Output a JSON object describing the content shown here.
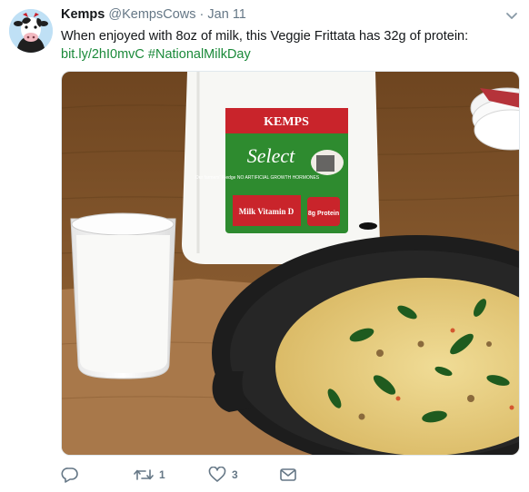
{
  "tweet": {
    "author_name": "Kemps",
    "author_handle": "@KempsCows",
    "separator": "·",
    "date": "Jan 11",
    "text": "When enjoyed with 8oz of milk, this Veggie Frittata has 32g of protein:",
    "link": "bit.ly/2hI0mvC",
    "hashtag": "#NationalMilkDay"
  },
  "media": {
    "jug_brand": "KEMPS",
    "jug_product": "Select",
    "jug_tagline": "Our farmers' Pledge NO ARTIFICIAL GROWTH HORMONES",
    "jug_label": "Milk Vitamin D",
    "jug_badge": "8g Protein"
  },
  "actions": {
    "reply_count": "",
    "retweet_count": "1",
    "like_count": "3"
  },
  "colors": {
    "link": "#1b8a3a",
    "muted": "#657786",
    "table_wood": "#8b5a2b",
    "egg": "#e8cf7a"
  }
}
